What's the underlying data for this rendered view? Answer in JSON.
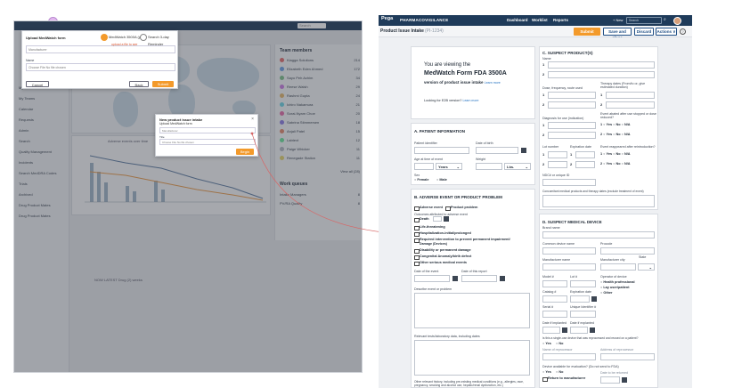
{
  "left": {
    "dashboard": {
      "search_placeholder": "Search",
      "map_caption": "Adverse events by countries",
      "chart_caption": "Adverse events over time",
      "sidebar_items": [
        "My Work",
        "My Teams",
        "Calendar",
        "Requests",
        "Admin",
        "Search",
        "Quality Management",
        "Incidents",
        "Search MedDRA Codes",
        "Trials",
        "Archived",
        "Drug Product Mates",
        "Drug Product Mates"
      ],
      "team_members_title": "Team members",
      "team_members": [
        {
          "name": "Kiagga Solutions",
          "count": "214",
          "color": "#e26b6b"
        },
        {
          "name": "Elizabeth Eden Ahmed",
          "count": "172",
          "color": "#6b9ee2"
        },
        {
          "name": "Sayo Peh Achim",
          "count": "34",
          "color": "#7cc08a"
        },
        {
          "name": "Reese Walsh",
          "count": "29",
          "color": "#c97be2"
        },
        {
          "name": "Rashmi Gupta",
          "count": "24",
          "color": "#e2b66b"
        },
        {
          "name": "Ichiro Nakamura",
          "count": "21",
          "color": "#6bd1e2"
        },
        {
          "name": "Sorai-Nyam Choe",
          "count": "20",
          "color": "#e26ba8"
        },
        {
          "name": "Sabrina Stimmersen",
          "count": "18",
          "color": "#8a7be2"
        },
        {
          "name": "Anjali Patel",
          "count": "15",
          "color": "#e2876b"
        },
        {
          "name": "Labtext",
          "count": "12",
          "color": "#6be29a"
        },
        {
          "name": "Paige Whicker",
          "count": "11",
          "color": "#b0b6c0"
        },
        {
          "name": "Renegade Station",
          "count": "11",
          "color": "#e2d26b"
        }
      ],
      "view_all": "View all (28)",
      "queues_title": "Work queues",
      "queues": [
        {
          "name": "Intake Managers",
          "count": "8"
        },
        {
          "name": "PV/RA Quality",
          "count": "8"
        }
      ],
      "bottom_caption": "NOW LATEST Drug (2) weeks"
    },
    "dialog1": {
      "title": "Upload MedWatch form",
      "option_a": "MedWatch 3500A (pdf)",
      "option_b": "Search 3-day Reminder",
      "field1_placeholder": "Manufacturer",
      "note": "upload a file to see",
      "field2_label": "Name",
      "field2_value": "Choose File  No file chosen",
      "cancel": "Cancel",
      "back": "Back",
      "submit": "Submit"
    },
    "dialog2": {
      "title": "New product issue intake",
      "subtitle": "Upload MedWatch form",
      "field1_placeholder": "Manufacturer",
      "field2_label": "Title",
      "field2_value": "Choose File  No file chosen",
      "begin": "Begin"
    }
  },
  "app": {
    "logo": "Pega",
    "product": "PHARMACOVIGILANCE",
    "nav": [
      "Dashboard",
      "Worklist",
      "Reports"
    ],
    "new_label": "+ New",
    "search_placeholder": "Search",
    "page_title": "Product Issue Intake",
    "case_id": "(PI-1234)",
    "buttons": {
      "submit": "Submit",
      "save_close": "Save and close",
      "discard": "Discard",
      "actions": "Actions ∨"
    },
    "intro": {
      "line1": "You are viewing the",
      "line2": "MedWatch Form FDA 3500A",
      "line3": "version of product issue intake",
      "learn_more": "Learn more",
      "line4": "Looking for E2B version?",
      "learn_more2": "Learn more"
    },
    "patient": {
      "title": "A. PATIENT INFORMATION",
      "identifier": "Patient identifier",
      "dob": "Date of birth",
      "age": "Age at time of event",
      "age_unit": "Years",
      "weight": "Weight",
      "weight_unit": "Lbs.",
      "sex": "Sex",
      "female": "Female",
      "male": "Male"
    },
    "adverse": {
      "title": "B. ADVERSE EVENT OR PRODUCT PROBLEM",
      "adverse_event": "Adverse event",
      "product_problem": "Product problem",
      "outcomes_label": "Outcomes attributed to adverse event",
      "outcomes": [
        "Death",
        "Life-threatening",
        "Hospitalization-initial/prolonged",
        "Required intervention to prevent permanent impairment/",
        "Damage (Devices)",
        "Disability or permanent damage",
        "Congenital Anomaly/birth defect",
        "Other serious medical events"
      ],
      "date_event": "Date of the event",
      "date_report": "Date of this report",
      "describe": "Describe event or problem",
      "tests": "Relevant tests/laboratory data, including dates",
      "history": "Other relevant history, including pre-existing medical conditions (e.g., allergies, race, pregnancy, smoking and alcohol use, hepatic/renal dysfunction, etc.)"
    },
    "products": {
      "title": "C. SUSPECT PRODUCT(S)",
      "name": "Name",
      "n1": "1",
      "n2": "2",
      "dose": "Dose, frequency, route used",
      "therapy": "Therapy dates (From/to or, give estimated duration)",
      "diagnosis": "Diagnosis for use (indication)",
      "abated": "Event abated after use stopped or dose reduced?",
      "lot": "Lot number",
      "expiration": "Expiration date",
      "reappeared": "Event reappeared after reintroduction?",
      "yes": "Yes",
      "no": "No",
      "na": "N/A",
      "ndc": "NDC# or unique ID",
      "concomitant": "Concomitant medical products and therapy dates (exclude treatment of event)"
    },
    "device": {
      "title": "D. SUSPECT MEDICAL DEVICE",
      "brand": "Brand name",
      "common": "Common device name",
      "procode": "Procode",
      "mfr_name": "Manufacturer name",
      "mfr_city": "Manufacturer city",
      "state": "State",
      "model": "Model #",
      "lot": "Lot #",
      "operator": "Operator of device",
      "health_pro": "Health professional",
      "lay_user": "Lay user/patient",
      "other": "Other",
      "catalog": "Catalog #",
      "expiration": "Expiration date",
      "serial": "Serial #",
      "udi": "Unique Identifier #",
      "implanted": "Date if implanted",
      "explanted": "Date if explanted",
      "single_use": "Is this a single-use device that was reprocessed and reused on a patient?",
      "yes": "Yes",
      "no": "No",
      "reprocessor_name": "Name of reprocessor",
      "reprocessor_addr": "Address of reprocessor",
      "evaluation": "Device available for evaluation? (Do not send to FDA)",
      "returned": "Date to be returned",
      "return_mfr": "Return to manufacturer"
    }
  }
}
